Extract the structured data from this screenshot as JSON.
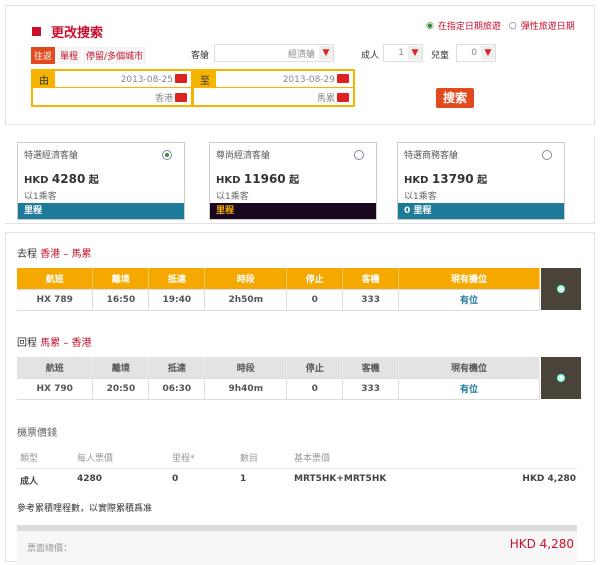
{
  "search": {
    "title": "更改搜索",
    "date_options": [
      "在指定日期旅遊",
      "彈性旅遊日期"
    ],
    "trip_types": [
      "往返",
      "單程",
      "停留/多個城市"
    ],
    "cabin_label": "客艙",
    "cabin_value": "經濟艙",
    "adult_label": "成人",
    "adult_value": "1",
    "child_label": "兒童",
    "child_value": "0",
    "from_label": "由",
    "to_label": "至",
    "depart_date": "2013-08-25",
    "return_date": "2013-08-29",
    "origin": "香港",
    "destination": "馬累",
    "search_button": "搜索"
  },
  "cards": [
    {
      "name": "特選經濟客艙",
      "currency": "HKD",
      "price": "4280",
      "suffix": "起",
      "pax": "以1乘客",
      "miles": "里程",
      "selected": true,
      "bar_color": "#1e7a99"
    },
    {
      "name": "尊尚經濟客艙",
      "currency": "HKD",
      "price": "11960",
      "suffix": "起",
      "pax": "以1乘客",
      "miles": "里程",
      "selected": false,
      "bar_color": "#1a0820"
    },
    {
      "name": "特選商務客艙",
      "currency": "HKD",
      "price": "13790",
      "suffix": "起",
      "pax": "以1乘客",
      "miles": "0 里程",
      "selected": false,
      "bar_color": "#1e7a99"
    }
  ],
  "columns": [
    "航班",
    "離境",
    "抵達",
    "時段",
    "停止",
    "客機",
    "現有機位"
  ],
  "outbound": {
    "label": "去程",
    "route": "香港 – 馬累",
    "row": [
      "HX 789",
      "16:50",
      "19:40",
      "2h50m",
      "0",
      "333",
      "有位"
    ]
  },
  "inbound": {
    "label": "回程",
    "route": "馬累 – 香港",
    "row": [
      "HX 790",
      "20:50",
      "06:30",
      "9h40m",
      "0",
      "333",
      "有位"
    ]
  },
  "price": {
    "title": "機票價錢",
    "headers": [
      "類型",
      "每人票價",
      "里程*",
      "數目",
      "基本票價"
    ],
    "row": [
      "成人",
      "4280",
      "0",
      "1",
      "MRT5HK+MRT5HK"
    ],
    "row_total": "HKD 4,280",
    "note": "參考累積哩程數，以實際累積爲准",
    "total_label": "票面總價：",
    "total_value": "HKD 4,280"
  },
  "colors": {
    "accent": "#c8102e",
    "orange": "#f5a800",
    "teal": "#1e7a99"
  }
}
